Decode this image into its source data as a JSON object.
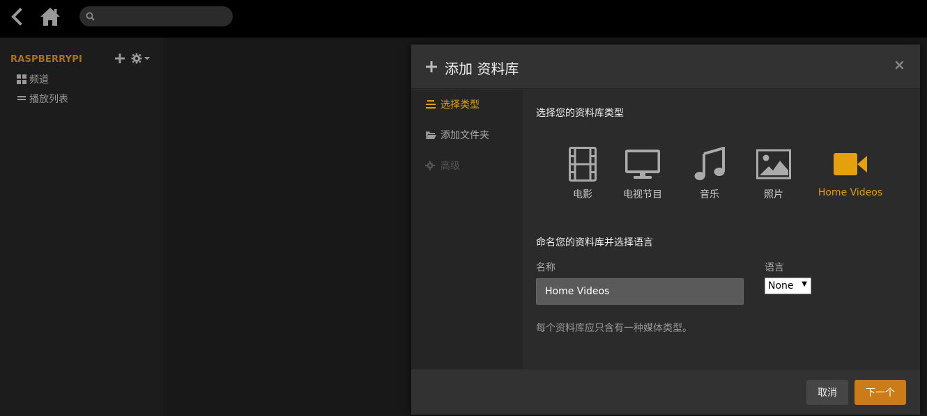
{
  "topbar": {
    "back_icon": "chevron-left-icon",
    "home_icon": "home-icon",
    "search_placeholder": "",
    "search_icon": "search-icon"
  },
  "sidebar": {
    "server_name": "RASPBERRYPI",
    "add_icon": "plus-icon",
    "settings_icon": "gear-icon",
    "items": [
      {
        "label": "频道",
        "icon": "grid-icon"
      },
      {
        "label": "播放列表",
        "icon": "list-icon"
      }
    ]
  },
  "modal": {
    "title": "添加 资料库",
    "close_label": "×",
    "nav": [
      {
        "label": "选择类型",
        "icon": "stack-icon",
        "state": "active"
      },
      {
        "label": "添加文件夹",
        "icon": "folder-icon",
        "state": "normal"
      },
      {
        "label": "高级",
        "icon": "gear-icon",
        "state": "disabled"
      }
    ],
    "content": {
      "type_heading": "选择您的资料库类型",
      "types": [
        {
          "label": "电影",
          "icon": "film-icon",
          "selected": false
        },
        {
          "label": "电视节目",
          "icon": "tv-icon",
          "selected": false
        },
        {
          "label": "音乐",
          "icon": "music-icon",
          "selected": false
        },
        {
          "label": "照片",
          "icon": "photo-icon",
          "selected": false
        },
        {
          "label": "Home Videos",
          "icon": "video-camera-icon",
          "selected": true
        }
      ],
      "name_heading": "命名您的资料库并选择语言",
      "name_label": "名称",
      "name_value": "Home Videos",
      "language_label": "语言",
      "language_value": "None",
      "help_text": "每个资料库应只含有一种媒体类型。"
    },
    "footer": {
      "cancel_label": "取消",
      "next_label": "下一个"
    }
  },
  "colors": {
    "accent": "#e5a00d",
    "next_button": "#cc7b19",
    "server_name": "#a8731c"
  }
}
